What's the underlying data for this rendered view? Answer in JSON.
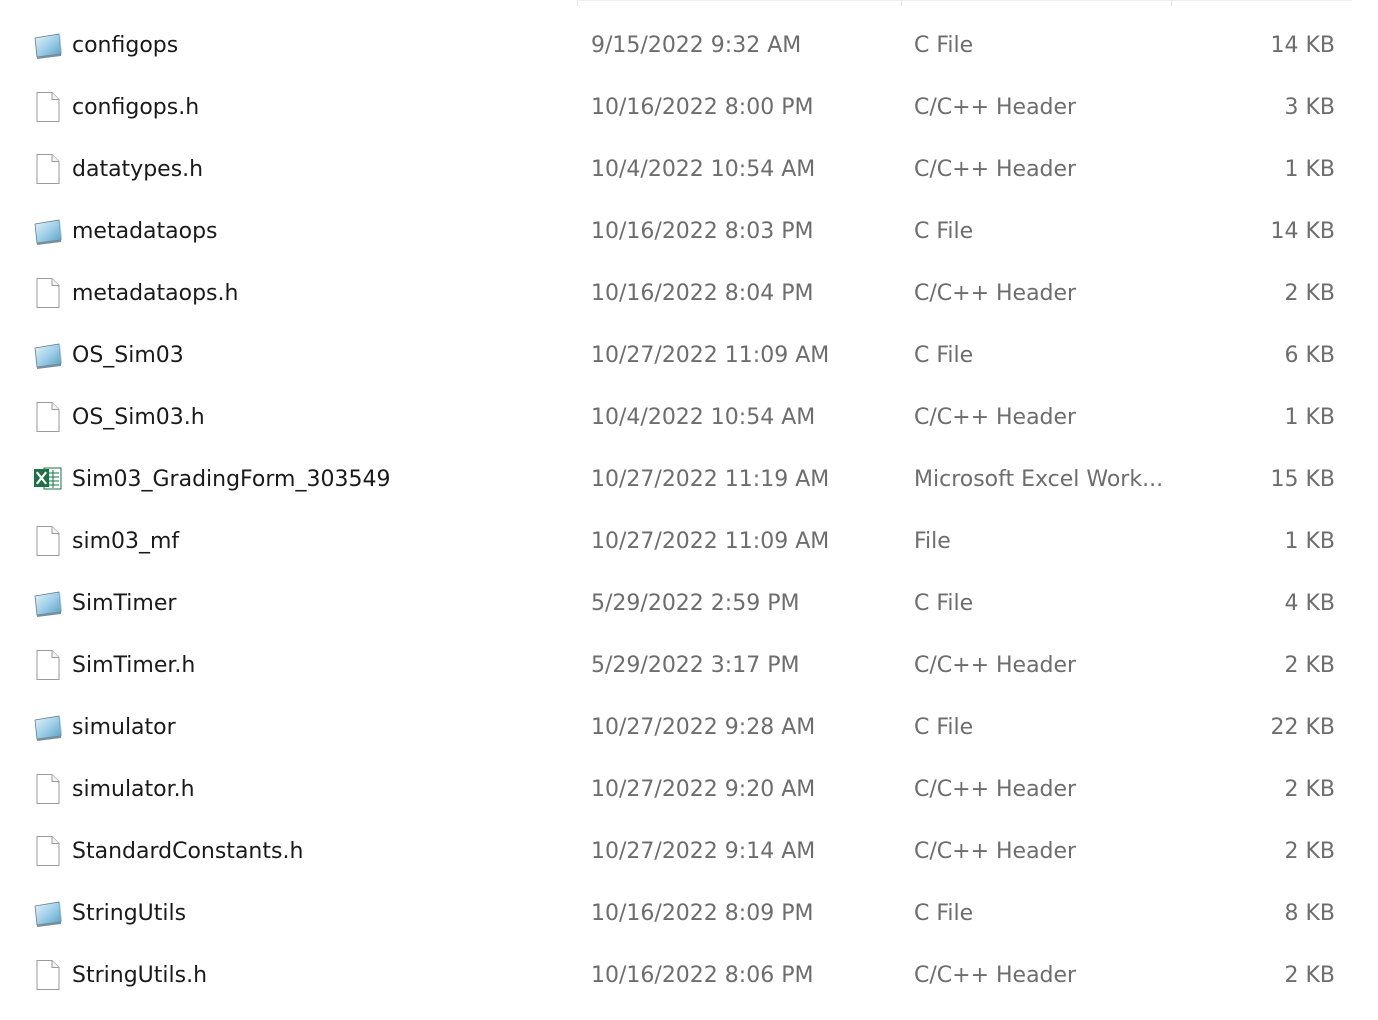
{
  "files": [
    {
      "name": "configops",
      "date": "9/15/2022 9:32 AM",
      "type": "C File",
      "size": "14 KB",
      "icon": "c-file-icon"
    },
    {
      "name": "configops.h",
      "date": "10/16/2022 8:00 PM",
      "type": "C/C++ Header",
      "size": "3 KB",
      "icon": "blank-file-icon"
    },
    {
      "name": "datatypes.h",
      "date": "10/4/2022 10:54 AM",
      "type": "C/C++ Header",
      "size": "1 KB",
      "icon": "blank-file-icon"
    },
    {
      "name": "metadataops",
      "date": "10/16/2022 8:03 PM",
      "type": "C File",
      "size": "14 KB",
      "icon": "c-file-icon"
    },
    {
      "name": "metadataops.h",
      "date": "10/16/2022 8:04 PM",
      "type": "C/C++ Header",
      "size": "2 KB",
      "icon": "blank-file-icon"
    },
    {
      "name": "OS_Sim03",
      "date": "10/27/2022 11:09 AM",
      "type": "C File",
      "size": "6 KB",
      "icon": "c-file-icon"
    },
    {
      "name": "OS_Sim03.h",
      "date": "10/4/2022 10:54 AM",
      "type": "C/C++ Header",
      "size": "1 KB",
      "icon": "blank-file-icon"
    },
    {
      "name": "Sim03_GradingForm_303549",
      "date": "10/27/2022 11:19 AM",
      "type": "Microsoft Excel Work...",
      "size": "15 KB",
      "icon": "excel-file-icon"
    },
    {
      "name": "sim03_mf",
      "date": "10/27/2022 11:09 AM",
      "type": "File",
      "size": "1 KB",
      "icon": "blank-file-icon"
    },
    {
      "name": "SimTimer",
      "date": "5/29/2022 2:59 PM",
      "type": "C File",
      "size": "4 KB",
      "icon": "c-file-icon"
    },
    {
      "name": "SimTimer.h",
      "date": "5/29/2022 3:17 PM",
      "type": "C/C++ Header",
      "size": "2 KB",
      "icon": "blank-file-icon"
    },
    {
      "name": "simulator",
      "date": "10/27/2022 9:28 AM",
      "type": "C File",
      "size": "22 KB",
      "icon": "c-file-icon"
    },
    {
      "name": "simulator.h",
      "date": "10/27/2022 9:20 AM",
      "type": "C/C++ Header",
      "size": "2 KB",
      "icon": "blank-file-icon"
    },
    {
      "name": "StandardConstants.h",
      "date": "10/27/2022 9:14 AM",
      "type": "C/C++ Header",
      "size": "2 KB",
      "icon": "blank-file-icon"
    },
    {
      "name": "StringUtils",
      "date": "10/16/2022 8:09 PM",
      "type": "C File",
      "size": "8 KB",
      "icon": "c-file-icon"
    },
    {
      "name": "StringUtils.h",
      "date": "10/16/2022 8:06 PM",
      "type": "C/C++ Header",
      "size": "2 KB",
      "icon": "blank-file-icon"
    }
  ],
  "colors": {
    "name_text": "#1a1a1a",
    "detail_text": "#6d6d6d",
    "excel_green": "#1e7145"
  }
}
